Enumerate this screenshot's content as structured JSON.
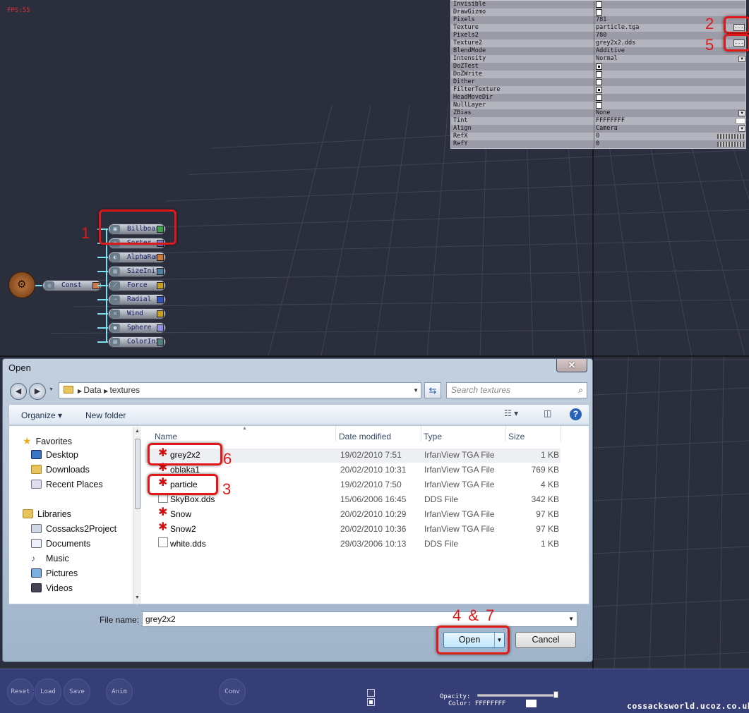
{
  "hud": {
    "fps": "FPS:55"
  },
  "properties": {
    "rows": [
      {
        "name": "Invisible",
        "kind": "check",
        "checked": false
      },
      {
        "name": "DrawGizmo",
        "kind": "check",
        "checked": false
      },
      {
        "name": "Pixels",
        "kind": "text",
        "value": "781"
      },
      {
        "name": "Texture",
        "kind": "file",
        "value": "particle.tga"
      },
      {
        "name": "Pixels2",
        "kind": "text",
        "value": "780"
      },
      {
        "name": "Texture2",
        "kind": "file",
        "value": "grey2x2.dds"
      },
      {
        "name": "BlendMode",
        "kind": "text",
        "value": "Additive"
      },
      {
        "name": "Intensity",
        "kind": "dropdown",
        "value": "Normal"
      },
      {
        "name": "DoZTest",
        "kind": "check",
        "checked": true
      },
      {
        "name": "DoZWrite",
        "kind": "check",
        "checked": false
      },
      {
        "name": "Dither",
        "kind": "check",
        "checked": false
      },
      {
        "name": "FilterTexture",
        "kind": "check",
        "checked": true
      },
      {
        "name": "HeadMoveDir",
        "kind": "check",
        "checked": false
      },
      {
        "name": "NullLayer",
        "kind": "check",
        "checked": false
      },
      {
        "name": "ZBias",
        "kind": "dropdown",
        "value": "None"
      },
      {
        "name": "Tint",
        "kind": "color",
        "value": "FFFFFFFF"
      },
      {
        "name": "Align",
        "kind": "dropdown",
        "value": "Camera"
      },
      {
        "name": "RefX",
        "kind": "slider",
        "value": "0"
      },
      {
        "name": "RefY",
        "kind": "slider",
        "value": "0"
      }
    ],
    "browse_label": "..."
  },
  "annotations": [
    "1",
    "2",
    "3",
    "4 & 7",
    "5",
    "6"
  ],
  "graph": {
    "root_icon": "gear-icon",
    "const_label": "Const",
    "nodes": [
      {
        "label": "Billboard",
        "port_color": "#3fa04a",
        "icon": "billboard-icon"
      },
      {
        "label": "Sorter",
        "port_color": "#7a7ad0",
        "icon": "sort-icon"
      },
      {
        "label": "AlphaRamp",
        "port_color": "#d07a3a",
        "icon": "ramp-icon"
      },
      {
        "label": "SizeInit",
        "port_color": "#4f7f9f",
        "icon": "size-icon"
      },
      {
        "label": "Force",
        "port_color": "#c8a020",
        "icon": "force-icon"
      },
      {
        "label": "Radial",
        "port_color": "#3050c0",
        "icon": "radial-icon"
      },
      {
        "label": "Wind",
        "port_color": "#c8a020",
        "icon": "wind-icon"
      },
      {
        "label": "Sphere",
        "port_color": "#9090e8",
        "icon": "sphere-icon"
      },
      {
        "label": "ColorInit",
        "port_color": "#4f7f7f",
        "icon": "color-icon"
      }
    ],
    "colors": {
      "const_port": "#d07a4a",
      "wire": "#7fe0ee"
    }
  },
  "dialog": {
    "title": "Open",
    "close_label": "✕",
    "breadcrumb": [
      "Data",
      "textures"
    ],
    "search_placeholder": "Search textures",
    "toolbar": {
      "organize": "Organize ▾",
      "new_folder": "New folder"
    },
    "nav": {
      "favorites": "Favorites",
      "favorites_items": [
        "Desktop",
        "Downloads",
        "Recent Places"
      ],
      "libraries": "Libraries",
      "libraries_items": [
        "Cossacks2Project",
        "Documents",
        "Music",
        "Pictures",
        "Videos"
      ]
    },
    "columns": [
      "Name",
      "Date modified",
      "Type",
      "Size"
    ],
    "files": [
      {
        "name": "grey2x2",
        "date": "19/02/2010 7:51",
        "type": "IrfanView TGA File",
        "size": "1 KB",
        "icon": "tga-file-icon"
      },
      {
        "name": "oblaka1",
        "date": "20/02/2010 10:31",
        "type": "IrfanView TGA File",
        "size": "769 KB",
        "icon": "tga-file-icon"
      },
      {
        "name": "particle",
        "date": "19/02/2010 7:50",
        "type": "IrfanView TGA File",
        "size": "4 KB",
        "icon": "tga-file-icon"
      },
      {
        "name": "SkyBox.dds",
        "date": "15/06/2006 16:45",
        "type": "DDS File",
        "size": "342 KB",
        "icon": "dds-file-icon"
      },
      {
        "name": "Snow",
        "date": "20/02/2010 10:29",
        "type": "IrfanView TGA File",
        "size": "97 KB",
        "icon": "tga-file-icon"
      },
      {
        "name": "Snow2",
        "date": "20/02/2010 10:36",
        "type": "IrfanView TGA File",
        "size": "97 KB",
        "icon": "tga-file-icon"
      },
      {
        "name": "white.dds",
        "date": "29/03/2006 10:13",
        "type": "DDS File",
        "size": "1 KB",
        "icon": "dds-file-icon"
      }
    ],
    "filename_label": "File name:",
    "filename_value": "grey2x2",
    "open_label": "Open",
    "cancel_label": "Cancel"
  },
  "bottombar": {
    "buttons": [
      "Reset",
      "Load",
      "Save",
      "Anim",
      "Conv"
    ],
    "opacity_label": "Opacity:",
    "opacity_level": 0.95,
    "color_label": "Color: FFFFFFFF"
  },
  "watermark": "cossacksworld.ucoz.co.uk"
}
